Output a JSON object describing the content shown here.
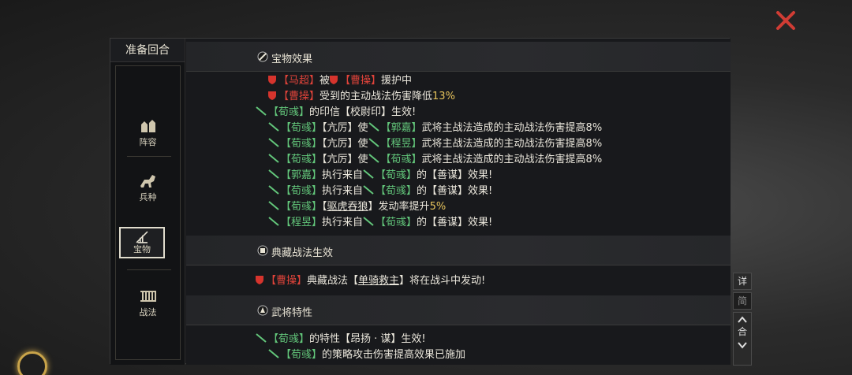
{
  "sidebar": {
    "title": "准备回合",
    "items": [
      {
        "label": "阵容",
        "icon": "formation-icon"
      },
      {
        "label": "兵种",
        "icon": "cavalry-icon"
      },
      {
        "label": "宝物",
        "icon": "treasure-icon"
      },
      {
        "label": "战法",
        "icon": "tactics-icon"
      }
    ]
  },
  "sections": [
    {
      "title": "宝物效果"
    },
    {
      "title": "典藏战法生效"
    },
    {
      "title": "武将特性"
    }
  ],
  "log": {
    "l1": {
      "a": "【马超】",
      "b": "被",
      "c": "【曹操】",
      "d": "援护中"
    },
    "l2": {
      "a": "【曹操】",
      "b": "受到的主动战法伤害降低",
      "c": "13%"
    },
    "l3": {
      "a": "【荀彧】",
      "b": "的印信【校尉印】生效!"
    },
    "l4": {
      "a": "【荀彧】",
      "b": "【亢厉】使",
      "c": "【郭嘉】",
      "d": "武将主战法造成的主动战法伤害提高8%"
    },
    "l5": {
      "a": "【荀彧】",
      "b": "【亢厉】使",
      "c": "【程昱】",
      "d": "武将主战法造成的主动战法伤害提高8%"
    },
    "l6": {
      "a": "【荀彧】",
      "b": "【亢厉】使",
      "c": "【荀彧】",
      "d": "武将主战法造成的主动战法伤害提高8%"
    },
    "l7": {
      "a": "【郭嘉】",
      "b": "执行来自",
      "c": "【荀彧】",
      "d": "的【善谋】效果!"
    },
    "l8": {
      "a": "【荀彧】",
      "b": "执行来自",
      "c": "【荀彧】",
      "d": "的【善谋】效果!"
    },
    "l9": {
      "a": "【荀彧】",
      "b": "【",
      "c": "驱虎吞狼",
      "d": "】发动率提升",
      "e": "5%"
    },
    "l10": {
      "a": "【程昱】",
      "b": "执行来自",
      "c": "【荀彧】",
      "d": "的【善谋】效果!"
    },
    "l11": {
      "a": "【曹操】",
      "b": "典藏战法【",
      "c": "单骑救主",
      "d": "】将在战斗中发动!"
    },
    "l12": {
      "a": "【荀彧】",
      "b": "的特性【昂扬 · 谋】生效!"
    },
    "l13": {
      "a": "【荀彧】",
      "b": "的策略攻击伤害提高效果已施加"
    }
  },
  "controls": {
    "detail": "详",
    "simple": "简",
    "collapse": "合"
  },
  "colors": {
    "red": "#e0433a",
    "green": "#63c77b",
    "yellow": "#e6c35c",
    "close": "#d03c34"
  }
}
